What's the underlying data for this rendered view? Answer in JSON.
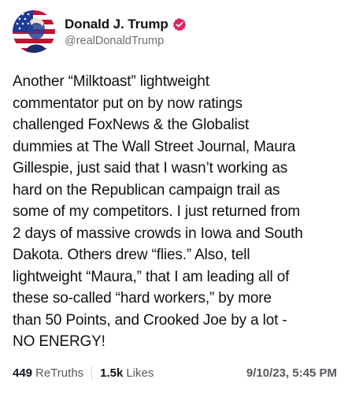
{
  "author": {
    "display_name": "Donald J. Trump",
    "handle": "@realDonaldTrump",
    "verified_icon": "verified-badge-icon",
    "badge_color": "#e0245e",
    "avatar_icon": "avatar-flag-portrait"
  },
  "post": {
    "text": "Another “Milktoast” lightweight\ncommentator put on by now ratings\nchallenged FoxNews & the Globalist\ndummies at The Wall Street Journal, Maura\nGillespie, just said that I wasn’t working as\nhard on the Republican campaign trail as\nsome of my competitors. I just returned from\n2 days of massive crowds in Iowa and South\nDakota. Others drew “flies.” Also, tell\nlightweight “Maura,” that I am leading all of\nthese so-called “hard workers,” by more\nthan 50 Points, and Crooked Joe by a lot -\nNO ENERGY!"
  },
  "stats": {
    "retruths_count": "449",
    "retruths_label": "ReTruths",
    "likes_count": "1.5k",
    "likes_label": "Likes",
    "timestamp": "9/10/23, 5:45 PM"
  }
}
